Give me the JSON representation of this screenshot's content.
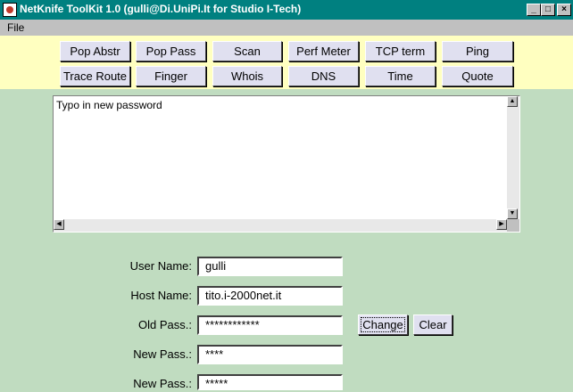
{
  "window": {
    "title": "NetKnife ToolKit 1.0 (gulli@Di.UniPi.It for Studio I-Tech)",
    "controls": {
      "minimize": "_",
      "maximize": "□",
      "close": "×"
    }
  },
  "menu": {
    "file": "File"
  },
  "toolbar": {
    "row1": [
      "Pop Abstr",
      "Pop Pass",
      "Scan",
      "Perf Meter",
      "TCP term",
      "Ping"
    ],
    "row2": [
      "Trace Route",
      "Finger",
      "Whois",
      "DNS",
      "Time",
      "Quote"
    ]
  },
  "output": {
    "text": "Typo in new password"
  },
  "scroll": {
    "up": "▲",
    "down": "▼",
    "left": "◀",
    "right": "▶"
  },
  "form": {
    "user_name_label": "User Name:",
    "user_name_value": "gulli",
    "host_name_label": "Host Name:",
    "host_name_value": "tito.i-2000net.it",
    "old_pass_label": "Old Pass.:",
    "old_pass_value": "************",
    "new_pass_label": "New Pass.:",
    "new_pass_value": "****",
    "new_pass2_label": "New Pass.:",
    "new_pass2_value": "*****",
    "change_label": "Change",
    "clear_label": "Clear"
  },
  "colors": {
    "titlebar": "#008080",
    "toolbar_bg": "#ffffc0",
    "body_bg": "#c0dcc0",
    "button_bg": "#e0e0f0"
  }
}
